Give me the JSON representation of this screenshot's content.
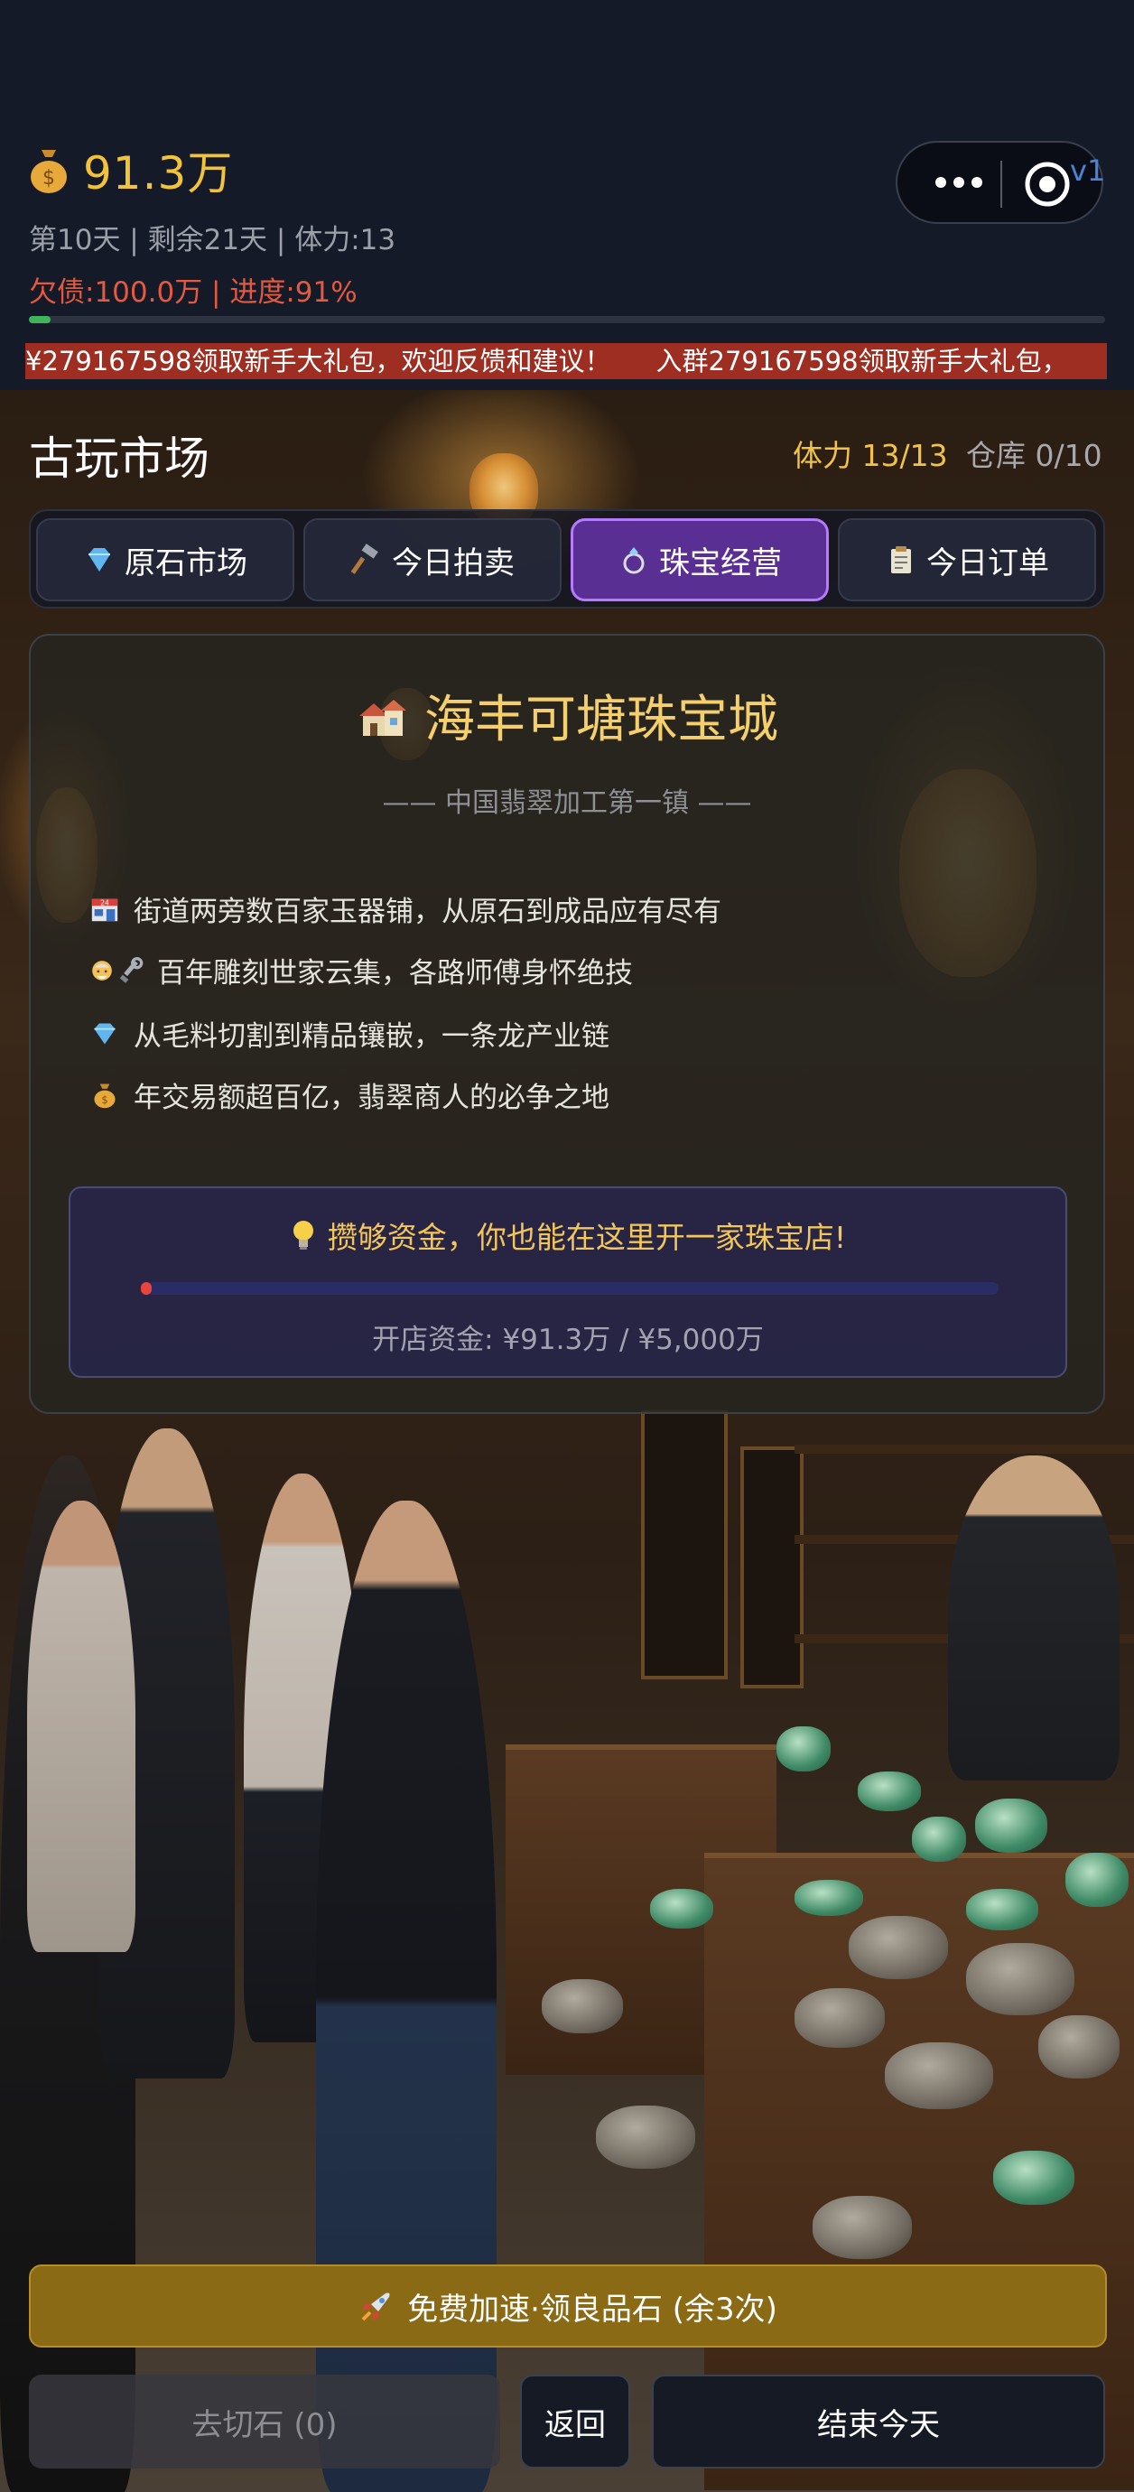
{
  "header": {
    "money": "91.3万",
    "money_icon": "money-bag-icon",
    "stats_line": "第10天 | 剩余21天 | 体力:13",
    "debt_line": "欠债:100.0万 | 进度:91%",
    "version_text": "v1",
    "progress_fraction": 0.0,
    "marquee_text": "¥279167598领取新手大礼包，欢迎反馈和建议！",
    "marquee_text_2": "入群279167598领取新手大礼包，"
  },
  "market": {
    "title": "古玩市场",
    "stamina": "体力 13/13",
    "warehouse": "仓库 0/10"
  },
  "tabs": [
    {
      "label": "原石市场",
      "icon": "diamond-icon",
      "active": false
    },
    {
      "label": "今日拍卖",
      "icon": "hammer-icon",
      "active": false
    },
    {
      "label": "珠宝经营",
      "icon": "ring-icon",
      "active": true
    },
    {
      "label": "今日订单",
      "icon": "clipboard-icon",
      "active": false
    }
  ],
  "card": {
    "title": "海丰可塘珠宝城",
    "title_icon": "houses-icon",
    "subtitle": "—— 中国翡翠加工第一镇 ——",
    "features": [
      {
        "text": "街道两旁数百家玉器铺，从原石到成品应有尽有",
        "icon": "store-icon"
      },
      {
        "text": "百年雕刻世家云集，各路师傅身怀绝技",
        "icon": "craftsman-icon"
      },
      {
        "text": "从毛料切割到精品镶嵌，一条龙产业链",
        "icon": "diamond-icon"
      },
      {
        "text": "年交易额超百亿，翡翠商人的必争之地",
        "icon": "money-bag-icon"
      }
    ],
    "tip": "攒够资金，你也能在这里开一家珠宝店!",
    "tip_icon": "lightbulb-icon",
    "capital_text": "开店资金: ¥91.3万 / ¥5,000万",
    "capital_progress": 0.018
  },
  "buttons": {
    "boost": "免费加速·领良品石 (余3次)",
    "boost_icon": "rocket-icon",
    "cut": "去切石 (0)",
    "back": "返回",
    "end_day": "结束今天"
  },
  "colors": {
    "accent_gold": "#f3c23b",
    "debt_red": "#e4593f",
    "tab_active": "#5a2f93",
    "boost_bg": "#8a6a14"
  }
}
